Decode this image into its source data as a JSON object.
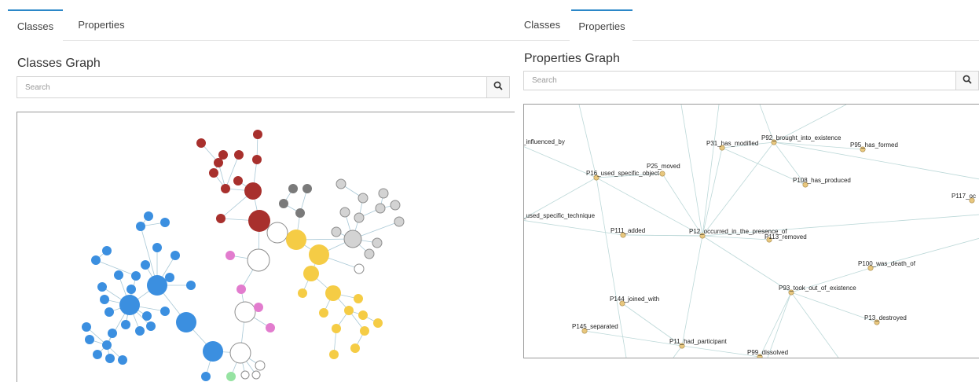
{
  "left": {
    "tabs": [
      {
        "label": "Classes",
        "active": true
      },
      {
        "label": "Properties",
        "active": false
      }
    ],
    "title": "Classes Graph",
    "search": {
      "placeholder": "Search",
      "value": ""
    },
    "search_icon": "search-icon"
  },
  "right": {
    "tabs": [
      {
        "label": "Classes",
        "active": false
      },
      {
        "label": "Properties",
        "active": true
      }
    ],
    "title": "Properties Graph",
    "search": {
      "placeholder": "Search",
      "value": ""
    },
    "search_icon": "search-icon",
    "graph_labels": [
      "_influenced_by",
      "P16_used_specific_object",
      "P25_moved",
      "P31_has_modified",
      "P92_brought_into_existence",
      "P95_has_formed",
      "P108_has_produced",
      "P117_oc",
      "_used_specific_technique",
      "P111_added",
      "P12_occurred_in_the_presence_of",
      "P113_removed",
      "P100_was_death_of",
      "P93_took_out_of_existence",
      "P144_joined_with",
      "P13_destroyed",
      "P145_separated",
      "P11_had_participant",
      "P99_dissolved"
    ]
  },
  "colors": {
    "accent": "#2b87c8",
    "blue": "#3b8fe0",
    "red": "#a8302d",
    "gray": "#7a7a7a",
    "light_gray": "#d3d3d3",
    "yellow": "#f5cc45",
    "pink": "#e27cce",
    "green": "#96e3a2",
    "white": "#ffffff",
    "property_node": "#e8c77e"
  }
}
